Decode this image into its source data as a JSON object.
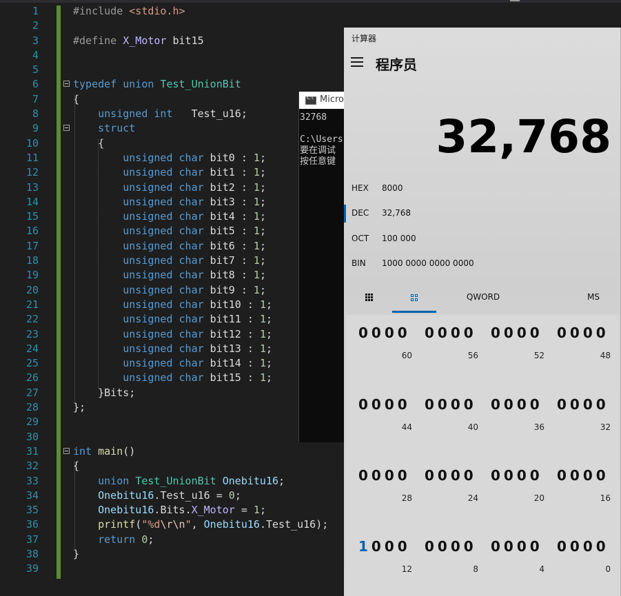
{
  "editor": {
    "line_numbers": [
      "1",
      "2",
      "3",
      "4",
      "5",
      "6",
      "7",
      "8",
      "9",
      "10",
      "11",
      "12",
      "13",
      "14",
      "15",
      "16",
      "17",
      "18",
      "19",
      "20",
      "21",
      "22",
      "23",
      "24",
      "25",
      "26",
      "27",
      "28",
      "29",
      "30",
      "31",
      "32",
      "33",
      "34",
      "35",
      "36",
      "37",
      "38",
      "39"
    ],
    "lines": [
      [
        [
          "pp",
          "#include "
        ],
        [
          "str",
          "<stdio.h>"
        ]
      ],
      [],
      [
        [
          "pp",
          "#define "
        ],
        [
          "mac",
          "X_Motor"
        ],
        [
          "plain",
          " bit15"
        ]
      ],
      [],
      [],
      [
        [
          "kw",
          "typedef"
        ],
        [
          "plain",
          " "
        ],
        [
          "kw",
          "union"
        ],
        [
          "plain",
          " "
        ],
        [
          "ty",
          "Test_UnionBit"
        ]
      ],
      [
        [
          "plain",
          "{"
        ]
      ],
      [
        [
          "plain",
          "    "
        ],
        [
          "kw",
          "unsigned"
        ],
        [
          "plain",
          " "
        ],
        [
          "kw",
          "int"
        ],
        [
          "plain",
          "   Test_u16;"
        ]
      ],
      [
        [
          "plain",
          "    "
        ],
        [
          "kw",
          "struct"
        ]
      ],
      [
        [
          "plain",
          "    {"
        ]
      ],
      [
        [
          "plain",
          "        "
        ],
        [
          "kw",
          "unsigned"
        ],
        [
          "plain",
          " "
        ],
        [
          "kw",
          "char"
        ],
        [
          "plain",
          " bit0 : "
        ],
        [
          "num",
          "1"
        ],
        [
          "plain",
          ";"
        ]
      ],
      [
        [
          "plain",
          "        "
        ],
        [
          "kw",
          "unsigned"
        ],
        [
          "plain",
          " "
        ],
        [
          "kw",
          "char"
        ],
        [
          "plain",
          " bit1 : "
        ],
        [
          "num",
          "1"
        ],
        [
          "plain",
          ";"
        ]
      ],
      [
        [
          "plain",
          "        "
        ],
        [
          "kw",
          "unsigned"
        ],
        [
          "plain",
          " "
        ],
        [
          "kw",
          "char"
        ],
        [
          "plain",
          " bit2 : "
        ],
        [
          "num",
          "1"
        ],
        [
          "plain",
          ";"
        ]
      ],
      [
        [
          "plain",
          "        "
        ],
        [
          "kw",
          "unsigned"
        ],
        [
          "plain",
          " "
        ],
        [
          "kw",
          "char"
        ],
        [
          "plain",
          " bit3 : "
        ],
        [
          "num",
          "1"
        ],
        [
          "plain",
          ";"
        ]
      ],
      [
        [
          "plain",
          "        "
        ],
        [
          "kw",
          "unsigned"
        ],
        [
          "plain",
          " "
        ],
        [
          "kw",
          "char"
        ],
        [
          "plain",
          " bit4 : "
        ],
        [
          "num",
          "1"
        ],
        [
          "plain",
          ";"
        ]
      ],
      [
        [
          "plain",
          "        "
        ],
        [
          "kw",
          "unsigned"
        ],
        [
          "plain",
          " "
        ],
        [
          "kw",
          "char"
        ],
        [
          "plain",
          " bit5 : "
        ],
        [
          "num",
          "1"
        ],
        [
          "plain",
          ";"
        ]
      ],
      [
        [
          "plain",
          "        "
        ],
        [
          "kw",
          "unsigned"
        ],
        [
          "plain",
          " "
        ],
        [
          "kw",
          "char"
        ],
        [
          "plain",
          " bit6 : "
        ],
        [
          "num",
          "1"
        ],
        [
          "plain",
          ";"
        ]
      ],
      [
        [
          "plain",
          "        "
        ],
        [
          "kw",
          "unsigned"
        ],
        [
          "plain",
          " "
        ],
        [
          "kw",
          "char"
        ],
        [
          "plain",
          " bit7 : "
        ],
        [
          "num",
          "1"
        ],
        [
          "plain",
          ";"
        ]
      ],
      [
        [
          "plain",
          "        "
        ],
        [
          "kw",
          "unsigned"
        ],
        [
          "plain",
          " "
        ],
        [
          "kw",
          "char"
        ],
        [
          "plain",
          " bit8 : "
        ],
        [
          "num",
          "1"
        ],
        [
          "plain",
          ";"
        ]
      ],
      [
        [
          "plain",
          "        "
        ],
        [
          "kw",
          "unsigned"
        ],
        [
          "plain",
          " "
        ],
        [
          "kw",
          "char"
        ],
        [
          "plain",
          " bit9 : "
        ],
        [
          "num",
          "1"
        ],
        [
          "plain",
          ";"
        ]
      ],
      [
        [
          "plain",
          "        "
        ],
        [
          "kw",
          "unsigned"
        ],
        [
          "plain",
          " "
        ],
        [
          "kw",
          "char"
        ],
        [
          "plain",
          " bit10 : "
        ],
        [
          "num",
          "1"
        ],
        [
          "plain",
          ";"
        ]
      ],
      [
        [
          "plain",
          "        "
        ],
        [
          "kw",
          "unsigned"
        ],
        [
          "plain",
          " "
        ],
        [
          "kw",
          "char"
        ],
        [
          "plain",
          " bit11 : "
        ],
        [
          "num",
          "1"
        ],
        [
          "plain",
          ";"
        ]
      ],
      [
        [
          "plain",
          "        "
        ],
        [
          "kw",
          "unsigned"
        ],
        [
          "plain",
          " "
        ],
        [
          "kw",
          "char"
        ],
        [
          "plain",
          " bit12 : "
        ],
        [
          "num",
          "1"
        ],
        [
          "plain",
          ";"
        ]
      ],
      [
        [
          "plain",
          "        "
        ],
        [
          "kw",
          "unsigned"
        ],
        [
          "plain",
          " "
        ],
        [
          "kw",
          "char"
        ],
        [
          "plain",
          " bit13 : "
        ],
        [
          "num",
          "1"
        ],
        [
          "plain",
          ";"
        ]
      ],
      [
        [
          "plain",
          "        "
        ],
        [
          "kw",
          "unsigned"
        ],
        [
          "plain",
          " "
        ],
        [
          "kw",
          "char"
        ],
        [
          "plain",
          " bit14 : "
        ],
        [
          "num",
          "1"
        ],
        [
          "plain",
          ";"
        ]
      ],
      [
        [
          "plain",
          "        "
        ],
        [
          "kw",
          "unsigned"
        ],
        [
          "plain",
          " "
        ],
        [
          "kw",
          "char"
        ],
        [
          "plain",
          " bit15 : "
        ],
        [
          "num",
          "1"
        ],
        [
          "plain",
          ";"
        ]
      ],
      [
        [
          "plain",
          "    }Bits;"
        ]
      ],
      [
        [
          "plain",
          "};"
        ]
      ],
      [],
      [],
      [
        [
          "kw",
          "int"
        ],
        [
          "plain",
          " "
        ],
        [
          "fn",
          "main"
        ],
        [
          "plain",
          "()"
        ]
      ],
      [
        [
          "plain",
          "{"
        ]
      ],
      [
        [
          "plain",
          "    "
        ],
        [
          "kw",
          "union"
        ],
        [
          "plain",
          " "
        ],
        [
          "ty",
          "Test_UnionBit"
        ],
        [
          "plain",
          " "
        ],
        [
          "var",
          "Onebitu16"
        ],
        [
          "plain",
          ";"
        ]
      ],
      [
        [
          "plain",
          "    "
        ],
        [
          "var",
          "Onebitu16"
        ],
        [
          "plain",
          "."
        ],
        [
          "member",
          "Test_u16"
        ],
        [
          "plain",
          " = "
        ],
        [
          "num",
          "0"
        ],
        [
          "plain",
          ";"
        ]
      ],
      [
        [
          "plain",
          "    "
        ],
        [
          "var",
          "Onebitu16"
        ],
        [
          "plain",
          "."
        ],
        [
          "member",
          "Bits"
        ],
        [
          "plain",
          "."
        ],
        [
          "mac",
          "X_Motor"
        ],
        [
          "plain",
          " = "
        ],
        [
          "num",
          "1"
        ],
        [
          "plain",
          ";"
        ]
      ],
      [
        [
          "plain",
          "    "
        ],
        [
          "fn",
          "printf"
        ],
        [
          "plain",
          "("
        ],
        [
          "str",
          "\"%d"
        ],
        [
          "esc",
          "\\r\\n"
        ],
        [
          "str",
          "\""
        ],
        [
          "plain",
          ", "
        ],
        [
          "var",
          "Onebitu16"
        ],
        [
          "plain",
          "."
        ],
        [
          "member",
          "Test_u16"
        ],
        [
          "plain",
          ");"
        ]
      ],
      [
        [
          "plain",
          "    "
        ],
        [
          "kw",
          "return"
        ],
        [
          "plain",
          " "
        ],
        [
          "num",
          "0"
        ],
        [
          "plain",
          ";"
        ]
      ],
      [
        [
          "plain",
          "}"
        ]
      ],
      []
    ]
  },
  "console": {
    "title": "Micro",
    "output": "32768\n\nC:\\Users\n要在调试\n按任意键"
  },
  "calculator": {
    "app_title": "计算器",
    "mode": "程序员",
    "display": "32,768",
    "radix": [
      {
        "name": "HEX",
        "value": "8000",
        "active": false
      },
      {
        "name": "DEC",
        "value": "32,768",
        "active": true
      },
      {
        "name": "OCT",
        "value": "100 000",
        "active": false
      },
      {
        "name": "BIN",
        "value": "1000 0000 0000 0000",
        "active": false
      }
    ],
    "tabs": {
      "keypad_icon": "keypad-icon",
      "bits_icon": "bit-toggle-icon",
      "word_size": "QWORD",
      "memory": "MS"
    },
    "bit_groups": [
      {
        "bits": "0000",
        "pos": "60"
      },
      {
        "bits": "0000",
        "pos": "56"
      },
      {
        "bits": "0000",
        "pos": "52"
      },
      {
        "bits": "0000",
        "pos": "48"
      },
      {
        "bits": "0000",
        "pos": "44"
      },
      {
        "bits": "0000",
        "pos": "40"
      },
      {
        "bits": "0000",
        "pos": "36"
      },
      {
        "bits": "0000",
        "pos": "32"
      },
      {
        "bits": "0000",
        "pos": "28"
      },
      {
        "bits": "0000",
        "pos": "24"
      },
      {
        "bits": "0000",
        "pos": "20"
      },
      {
        "bits": "0000",
        "pos": "16"
      },
      {
        "bits": "1000",
        "pos": "12"
      },
      {
        "bits": "0000",
        "pos": "8"
      },
      {
        "bits": "0000",
        "pos": "4"
      },
      {
        "bits": "0000",
        "pos": "0"
      }
    ],
    "accent_color": "#0063b1"
  }
}
